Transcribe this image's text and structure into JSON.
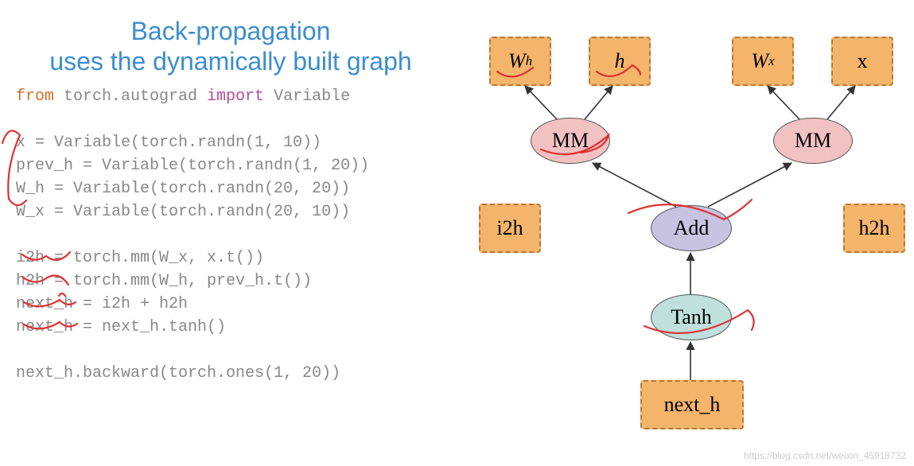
{
  "title_line1": "Back-propagation",
  "title_line2": "uses the dynamically built graph",
  "code": {
    "l1a": "from",
    "l1b": " torch.autograd ",
    "l1c": "import",
    "l1d": " Variable",
    "l3": "x = Variable(torch.randn(1, 10))",
    "l4": "prev_h = Variable(torch.randn(1, 20))",
    "l5": "W_h = Variable(torch.randn(20, 20))",
    "l6": "W_x = Variable(torch.randn(20, 10))",
    "l8": "i2h = torch.mm(W_x, x.t())",
    "l9": "h2h = torch.mm(W_h, prev_h.t())",
    "l10": "next_h = i2h + h2h",
    "l11": "next_h = next_h.tanh()",
    "l13": "next_h.backward(torch.ones(1, 20))"
  },
  "nodes": {
    "Wh": "W",
    "Wh_sub": "h",
    "h": "h",
    "Wx": "W",
    "Wx_sub": "x",
    "x": "x",
    "mm1": "MM",
    "mm2": "MM",
    "i2h": "i2h",
    "add": "Add",
    "h2h": "h2h",
    "tanh": "Tanh",
    "nexth": "next_h"
  },
  "watermark": "https://blog.csdn.net/weixin_45918732"
}
